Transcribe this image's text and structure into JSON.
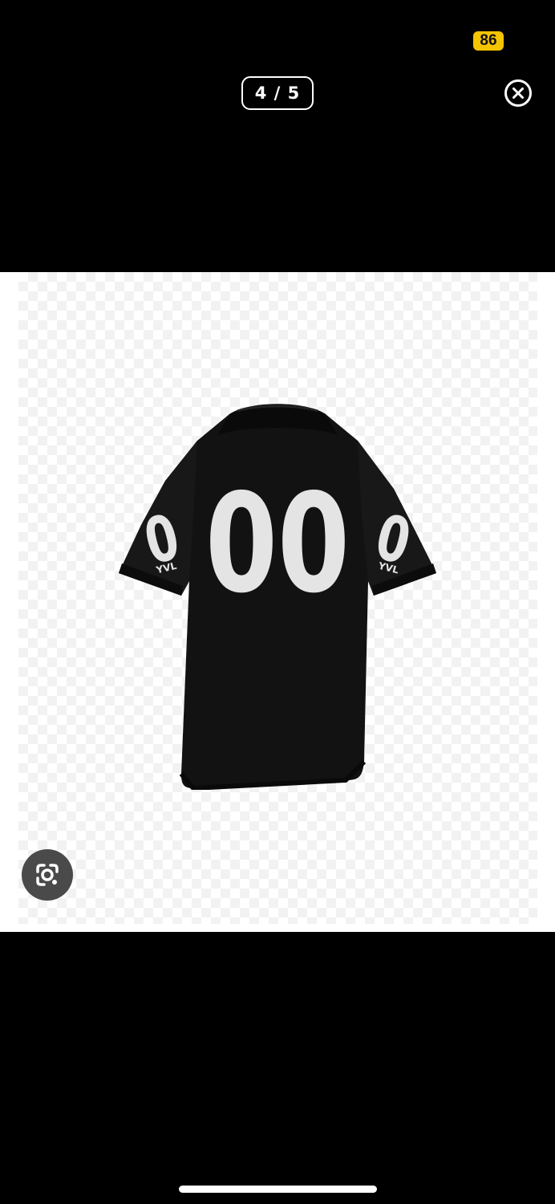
{
  "status_bar": {
    "battery_level": "86",
    "battery_color": "#f5c400"
  },
  "viewer": {
    "counter": "4 / 5",
    "close_icon": "close-circle-icon",
    "lens_icon": "google-lens-icon"
  },
  "image": {
    "back_number": "00",
    "sleeve_number_left": "0",
    "sleeve_number_right": "0",
    "sleeve_brand_left": "YVL",
    "sleeve_brand_right": "YVL",
    "shirt_color": "#121212",
    "print_color": "#e4e4e4"
  }
}
